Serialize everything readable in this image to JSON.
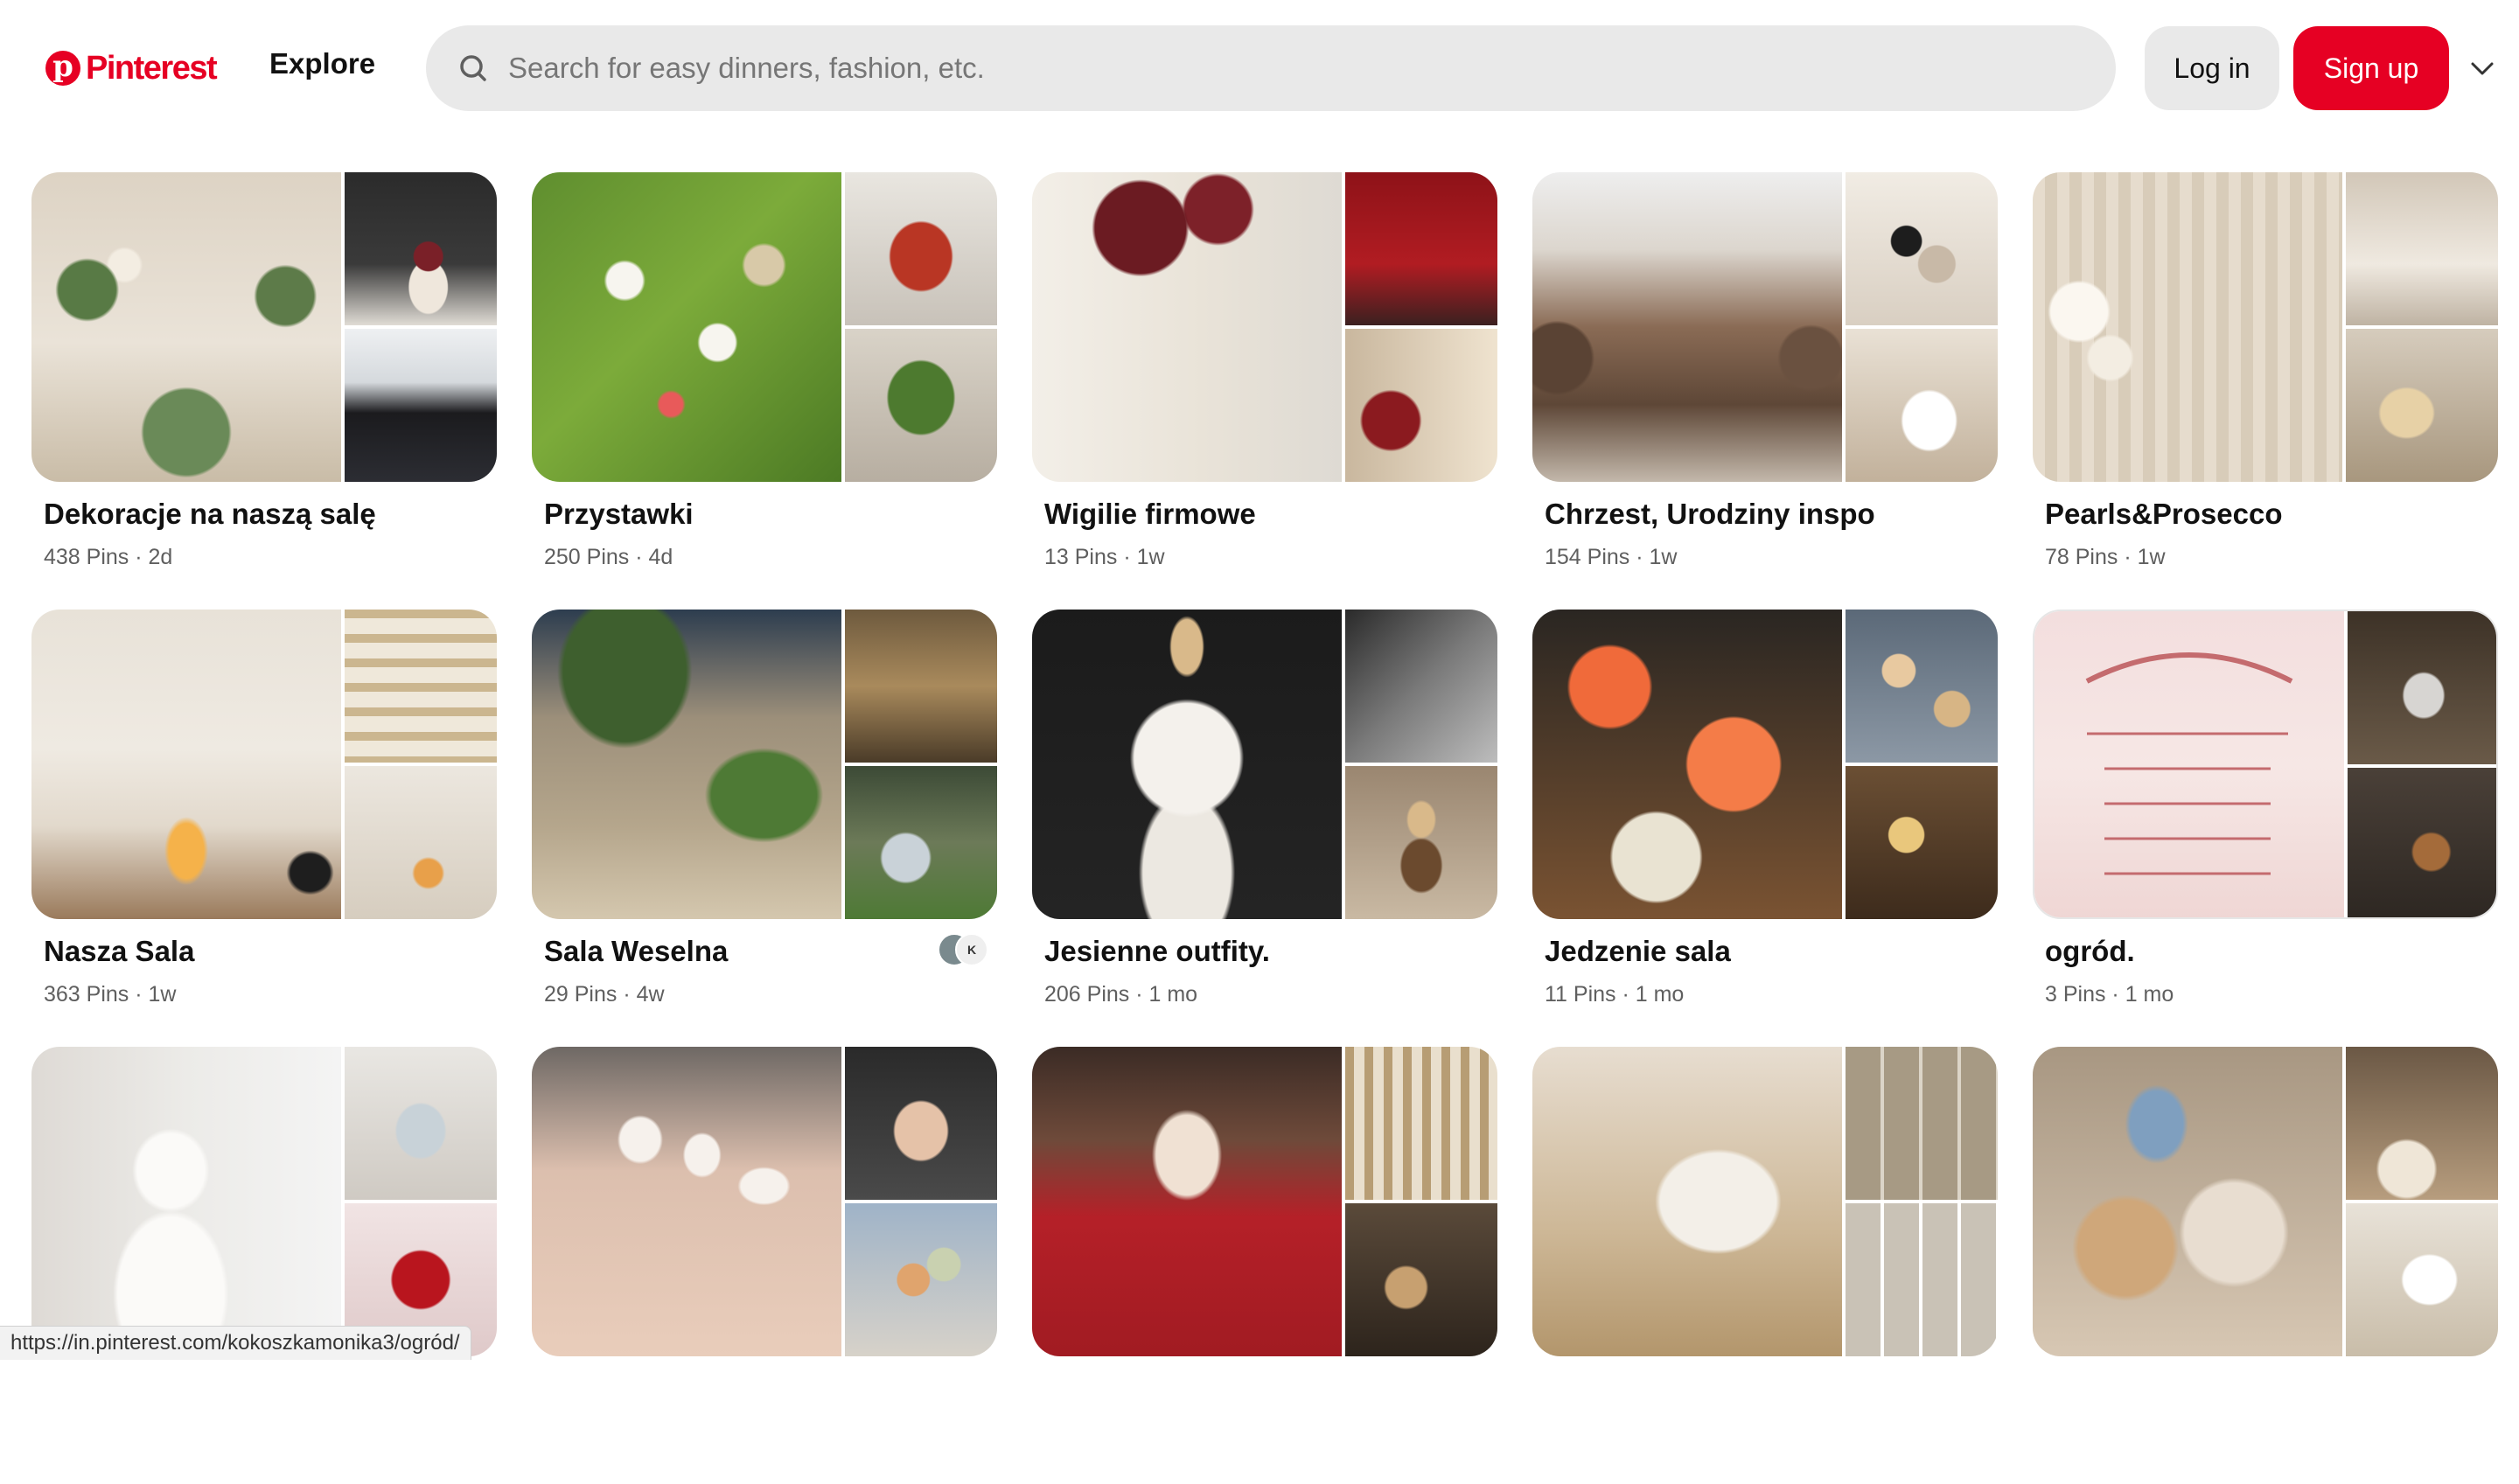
{
  "header": {
    "logo_text": "Pinterest",
    "logo_icon": "pinterest-logo-icon",
    "explore_label": "Explore",
    "search_placeholder": "Search for easy dinners, fashion, etc.",
    "login_label": "Log in",
    "signup_label": "Sign up",
    "brand_color": "#e60023",
    "menu_icon": "chevron-down-icon"
  },
  "boards": [
    {
      "title": "Dekoracje na naszą salę",
      "meta": "438 Pins · 2d"
    },
    {
      "title": "Przystawki",
      "meta": "250 Pins · 4d"
    },
    {
      "title": "Wigilie firmowe",
      "meta": "13 Pins · 1w"
    },
    {
      "title": "Chrzest, Urodziny inspo",
      "meta": "154 Pins · 1w"
    },
    {
      "title": "Pearls&Prosecco",
      "meta": "78 Pins · 1w"
    },
    {
      "title": "Nasza Sala",
      "meta": "363 Pins · 1w"
    },
    {
      "title": "Sala Weselna",
      "meta": "29 Pins · 4w",
      "collaborator_initial": "K"
    },
    {
      "title": "Jesienne outfity.",
      "meta": "206 Pins · 1 mo"
    },
    {
      "title": "Jedzenie sala",
      "meta": "11 Pins · 1 mo"
    },
    {
      "title": "ogród.",
      "meta": "3 Pins · 1 mo"
    }
  ],
  "status_url": "https://in.pinterest.com/kokoszkamonika3/ogród/"
}
